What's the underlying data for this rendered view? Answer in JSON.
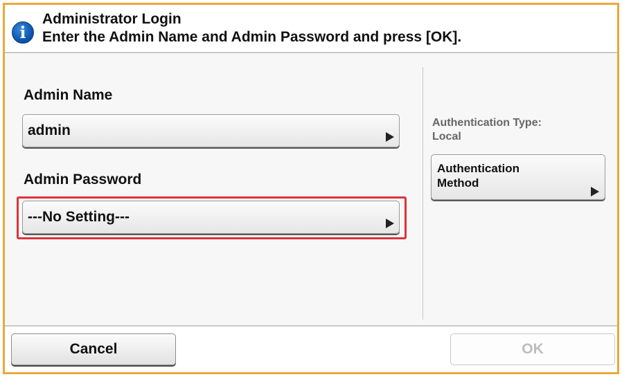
{
  "header": {
    "title": "Administrator Login",
    "subtitle": "Enter the Admin Name and Admin Password and press [OK]."
  },
  "admin_name": {
    "label": "Admin Name",
    "value": "admin"
  },
  "admin_password": {
    "label": "Admin Password",
    "value": "---No Setting---"
  },
  "auth": {
    "type_label": "Authentication Type:",
    "type_value": "Local",
    "method_line1": "Authentication",
    "method_line2": "Method"
  },
  "footer": {
    "cancel_label": "Cancel",
    "ok_label": "OK"
  },
  "colors": {
    "frame_border": "#e8a93a",
    "highlight": "#e0313a",
    "info_icon": "#0d56b0",
    "disabled_text": "#bdbdbd"
  },
  "icons": {
    "info": "info-icon",
    "arrow": "triangle-right-icon"
  }
}
